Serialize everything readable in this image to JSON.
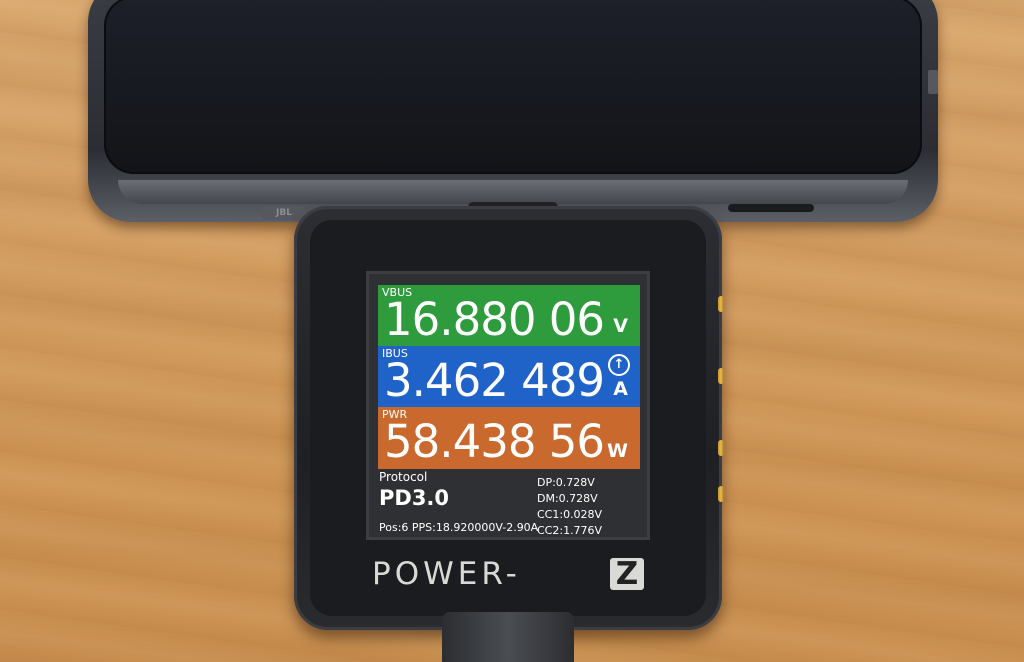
{
  "phone": {
    "logo_text": "JBL"
  },
  "meter": {
    "vbus": {
      "label": "VBUS",
      "value": "16.880 06",
      "unit": "V"
    },
    "ibus": {
      "label": "IBUS",
      "value": "3.462 489",
      "unit": "A",
      "direction_icon": "arrow-up-circle-icon"
    },
    "pwr": {
      "label": "PWR",
      "value": "58.438 56",
      "unit": "W"
    },
    "protocol": {
      "label": "Protocol",
      "value": "PD3.0"
    },
    "lines": [
      "DP:0.728V",
      "DM:0.728V",
      "CC1:0.028V",
      "CC2:1.776V"
    ],
    "pps": "Pos:6 PPS:18.920000V-2.90A",
    "brand": {
      "word": "POWER-",
      "badge": "Z"
    },
    "colors": {
      "vbus": "#2e9b3d",
      "ibus": "#1f62c8",
      "pwr": "#c9692e"
    }
  }
}
